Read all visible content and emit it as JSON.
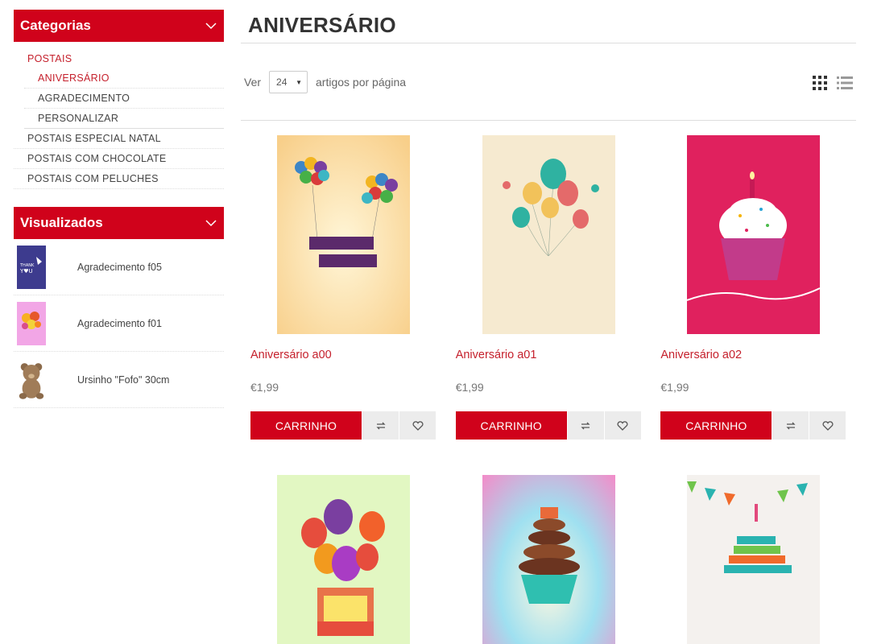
{
  "sidebar": {
    "categories_title": "Categorias",
    "categories": {
      "parent": "POSTAIS",
      "children": [
        "ANIVERSÁRIO",
        "AGRADECIMENTO",
        "PERSONALIZAR"
      ],
      "others": [
        "POSTAIS ESPECIAL NATAL",
        "POSTAIS COM CHOCOLATE",
        "POSTAIS COM PELUCHES"
      ]
    },
    "viewed_title": "Visualizados",
    "viewed": [
      {
        "name": "Agradecimento f05"
      },
      {
        "name": "Agradecimento f01"
      },
      {
        "name": "Ursinho \"Fofo\" 30cm"
      }
    ]
  },
  "main": {
    "title": "ANIVERSÁRIO",
    "toolbar": {
      "ver_label": "Ver",
      "per_page_value": "24",
      "per_page_suffix": "artigos por página"
    },
    "products": [
      {
        "name": "Aniversário a00",
        "price": "€1,99",
        "cart": "CARRINHO"
      },
      {
        "name": "Aniversário a01",
        "price": "€1,99",
        "cart": "CARRINHO"
      },
      {
        "name": "Aniversário a02",
        "price": "€1,99",
        "cart": "CARRINHO"
      }
    ]
  },
  "colors": {
    "accent": "#d0021b",
    "link": "#c5202c"
  }
}
